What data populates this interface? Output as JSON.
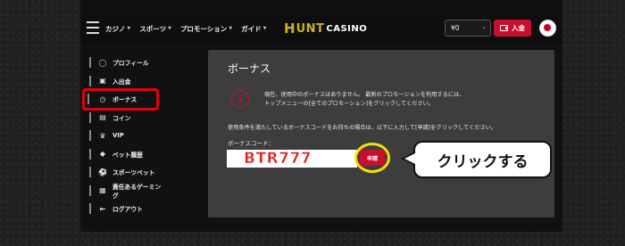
{
  "header": {
    "nav": [
      {
        "label": "カジノ"
      },
      {
        "label": "スポーツ"
      },
      {
        "label": "プロモーション"
      },
      {
        "label": "ガイド"
      }
    ],
    "logo": {
      "h": "H",
      "unt": "UNT",
      "casino": "CASINO"
    },
    "balance": "¥0",
    "deposit_label": "入金"
  },
  "sidebar": {
    "items": [
      {
        "label": "プロフィール",
        "icon": "user-icon"
      },
      {
        "label": "入出金",
        "icon": "wallet-icon"
      },
      {
        "label": "ボーナス",
        "icon": "bonus-icon",
        "active": true
      },
      {
        "label": "コイン",
        "icon": "coin-icon"
      },
      {
        "label": "VIP",
        "icon": "crown-icon"
      },
      {
        "label": "ベット履歴",
        "icon": "diamond-icon"
      },
      {
        "label": "スポーツベット",
        "icon": "sports-icon"
      },
      {
        "label": "責任あるゲーミング",
        "icon": "shield-icon"
      },
      {
        "label": "ログアウト",
        "icon": "logout-icon"
      }
    ]
  },
  "panel": {
    "title": "ボーナス",
    "notice_line1": "現在、使用中のボーナスはありません。 最新のプロモーションを利用するには、",
    "notice_line2": "トップメニューの[全てのプロモーション]をクリックしてください。",
    "instruction": "使用条件を満たしているボーナスコードをお持ちの場合は、以下に入力して[申請]をクリックしてください。",
    "code_label": "ボーナスコード：",
    "code_value": "BTR777",
    "apply_label": "申請"
  },
  "callout": {
    "text": "クリックする"
  },
  "colors": {
    "accent_red": "#c8102e",
    "highlight_yellow": "#f2e100",
    "highlight_red": "#e0000f"
  }
}
